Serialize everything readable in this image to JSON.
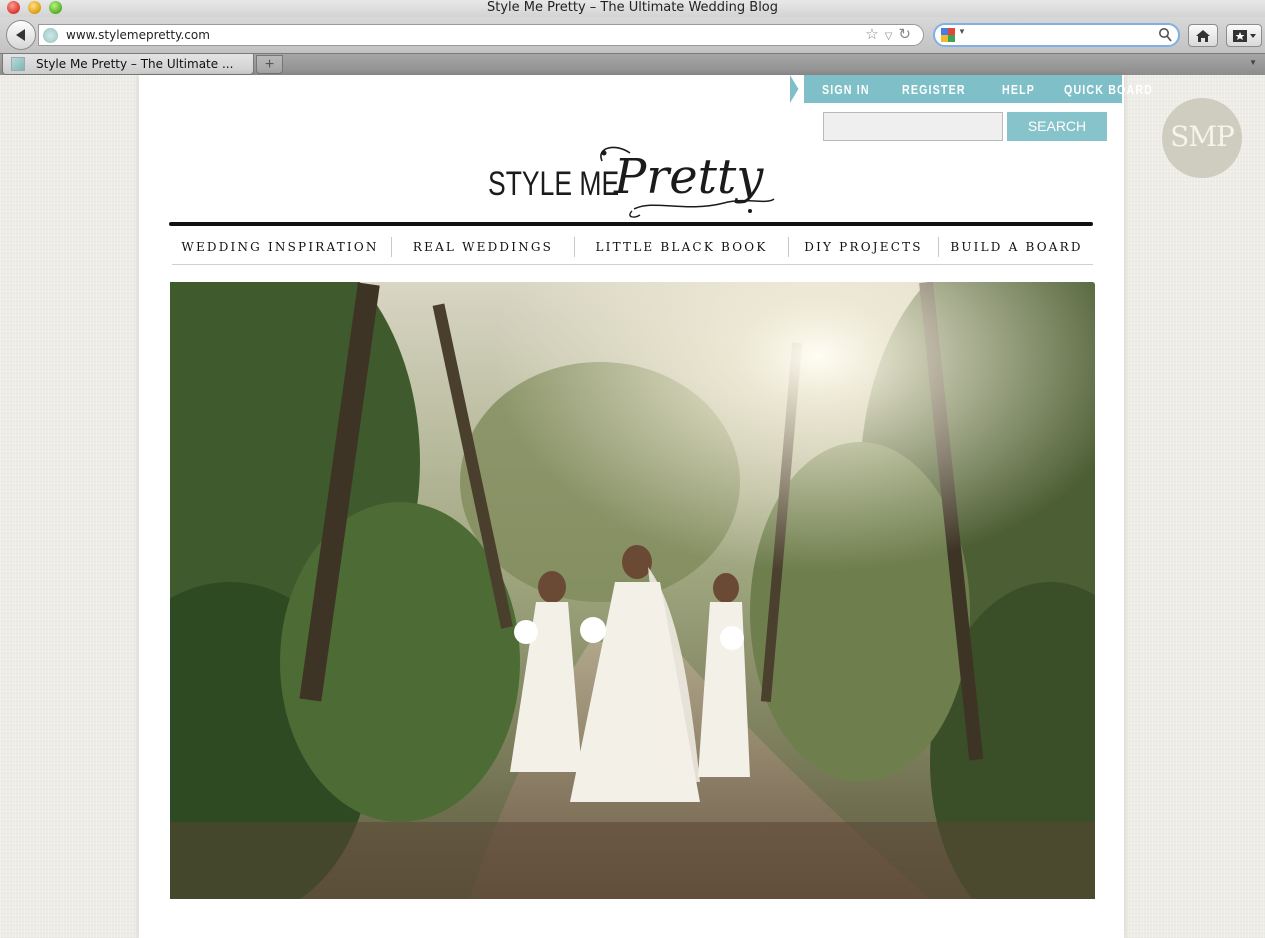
{
  "window": {
    "title": "Style Me Pretty – The Ultimate Wedding Blog"
  },
  "browser": {
    "url": "www.stylemepretty.com",
    "search_value": "",
    "tab_title": "Style Me Pretty – The Ultimate ...",
    "new_tab_label": "+"
  },
  "header": {
    "util_links": [
      "SIGN IN",
      "REGISTER",
      "HELP",
      "QUICK BOARD"
    ],
    "search_placeholder": "",
    "search_button": "SEARCH"
  },
  "logo": {
    "part1": "STYLE ME",
    "part2": "Pretty"
  },
  "nav": [
    "WEDDING INSPIRATION",
    "REAL WEDDINGS",
    "LITTLE BLACK BOOK",
    "DIY PROJECTS",
    "BUILD A BOARD"
  ],
  "badge": "SMP",
  "colors": {
    "accent": "#7fc0c8",
    "search_button": "#86c3cb",
    "page_bg": "#edece6"
  },
  "hero": {
    "description_icon": "bride-and-bridesmaids-forest-photo"
  }
}
